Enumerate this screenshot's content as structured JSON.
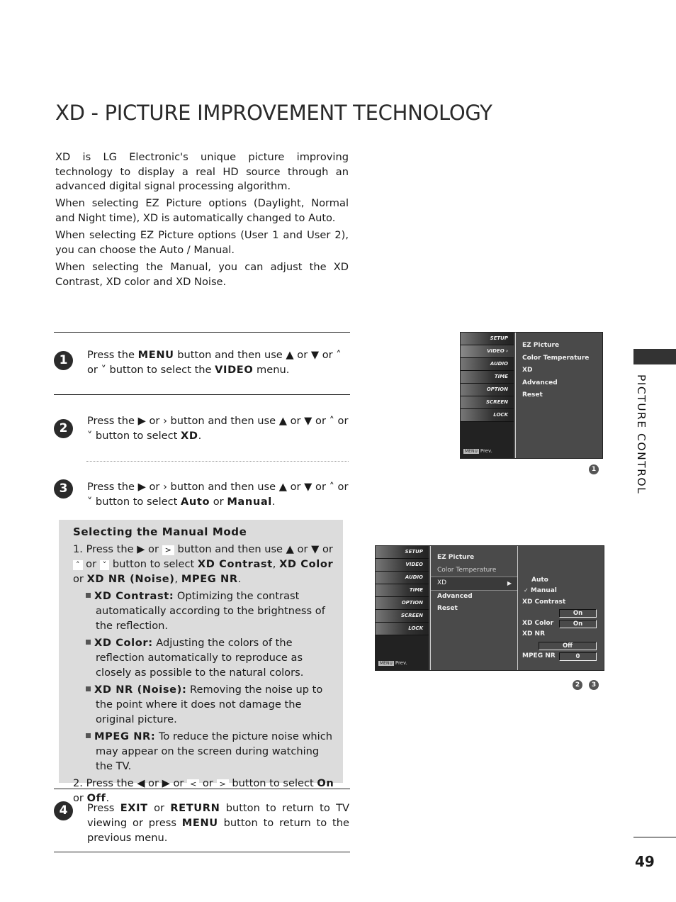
{
  "title": "XD - PICTURE IMPROVEMENT TECHNOLOGY",
  "intro": [
    "XD is LG Electronic's unique picture improving technology to display a real HD source through an advanced digital signal processing algorithm.",
    "When selecting EZ Picture options (Daylight, Normal and Night time), XD is automatically changed to Auto.",
    "When selecting EZ Picture options (User 1 and User 2), you can choose the Auto / Manual.",
    "When selecting the Manual, you can adjust the XD Contrast, XD color and XD Noise."
  ],
  "steps": [
    {
      "num": "1",
      "a": "Press the ",
      "k1": "MENU",
      "b": " button and then use ▲ or ▼  or  ˄  or  ˅  button to select the ",
      "k2": "VIDEO",
      "c": " menu."
    },
    {
      "num": "2",
      "a": "Press the  ▶  or  ›  button and then use ▲ or ▼  or  ˄  or  ˅  button to select ",
      "k1": "XD",
      "b": "."
    },
    {
      "num": "3",
      "a": "Press the  ▶  or  ›  button and then use ▲ or ▼  or  ˄  or  ˅  button to select ",
      "k1": "Auto",
      "b": " or ",
      "k2": "Manual",
      "c": "."
    },
    {
      "num": "4",
      "a": "Press ",
      "k1": "EXIT",
      "b": " or ",
      "k2": "RETURN",
      "c": " button to return to TV viewing or press ",
      "k3": "MENU",
      "d": " button to return to the previous menu."
    }
  ],
  "manual_mode": {
    "heading": "Selecting the Manual Mode",
    "item1": {
      "a": "1. Press the  ▶  or ",
      "g1": ">",
      "b": " button and then use ▲ or ▼ or ",
      "g2": "˄",
      "c": " or ",
      "g3": "˅",
      "d": " button to select ",
      "k1": "XD Contrast",
      "e": ", ",
      "k2": "XD Color",
      "f": " or ",
      "k3": "XD NR (Noise)",
      "g": ", ",
      "k4": "MPEG NR",
      "h": "."
    },
    "bullets": [
      {
        "term": "XD Contrast:",
        "text": " Optimizing the contrast automatically according to the brightness of the reflection."
      },
      {
        "term": "XD Color:",
        "text": " Adjusting the colors of the reflection automatically to reproduce as closely as possible to the natural colors."
      },
      {
        "term": "XD NR (Noise):",
        "text": " Removing the noise up to the point where it does not damage the original picture."
      },
      {
        "term": "MPEG NR:",
        "text": " To reduce the picture noise which may appear on the screen during watching the TV."
      }
    ],
    "item2": {
      "a": "2. Press the ◀ or ▶ or ",
      "g1": "<",
      "b": " or ",
      "g2": ">",
      "c": " button to select ",
      "k1": "On",
      "d": " or ",
      "k2": "Off",
      "e": "."
    }
  },
  "tv_sidebar": [
    "SETUP",
    "VIDEO",
    "AUDIO",
    "TIME",
    "OPTION",
    "SCREEN",
    "LOCK"
  ],
  "tv_prev": {
    "key": "MENU",
    "label": "Prev."
  },
  "screen1": {
    "menu": [
      "EZ Picture",
      "Color Temperature",
      "XD",
      "Advanced",
      "Reset"
    ],
    "figure": "1"
  },
  "screen2": {
    "menu": [
      "EZ Picture",
      "Color Temperature",
      "XD",
      "Advanced",
      "Reset"
    ],
    "xd_arrow": "▶",
    "sub": {
      "auto": "Auto",
      "manual": "Manual",
      "check": "✓",
      "xd_contrast_label": "XD Contrast",
      "xd_contrast_value": "On",
      "xd_color_label": "XD Color",
      "xd_color_value": "On",
      "xd_nr_label": "XD NR",
      "xd_nr_value": "Off",
      "mpeg_nr_label": "MPEG NR",
      "mpeg_nr_value": "0"
    },
    "figures": [
      "2",
      "3"
    ]
  },
  "side_label": "PICTURE CONTROL",
  "page_number": "49"
}
